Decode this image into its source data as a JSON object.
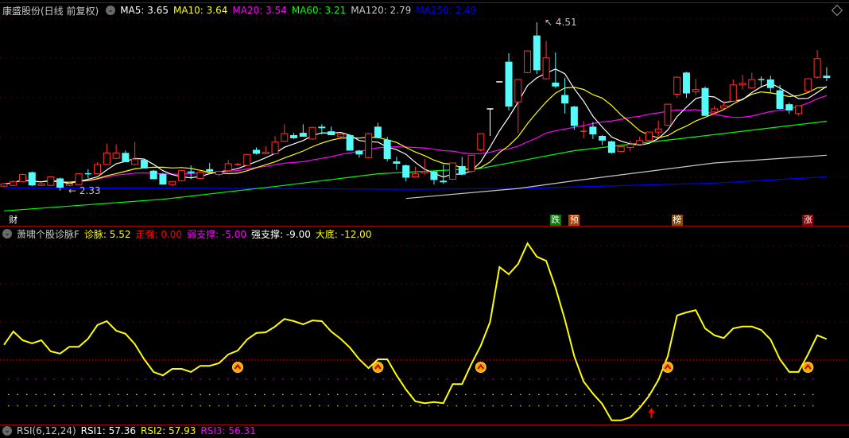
{
  "header": {
    "title": "康盛股份(日线 前复权)",
    "ma": [
      {
        "label": "MA5: 3.65",
        "color": "#ffffff"
      },
      {
        "label": "MA10: 3.64",
        "color": "#ffff00"
      },
      {
        "label": "MA20: 3.54",
        "color": "#ff00ff"
      },
      {
        "label": "MA60: 3.21",
        "color": "#00ff00"
      },
      {
        "label": "MA120: 2.79",
        "color": "#c8c8c8"
      },
      {
        "label": "MA250: 2.49",
        "color": "#0000ff"
      }
    ]
  },
  "main_chart": {
    "high_label": "4.51",
    "low_label": "2.33",
    "candles": [
      [
        2.39,
        2.43,
        2.38,
        2.42
      ],
      [
        2.4,
        2.46,
        2.39,
        2.45
      ],
      [
        2.45,
        2.55,
        2.44,
        2.54
      ],
      [
        2.57,
        2.58,
        2.39,
        2.4
      ],
      [
        2.4,
        2.43,
        2.39,
        2.42
      ],
      [
        2.4,
        2.52,
        2.39,
        2.51
      ],
      [
        2.49,
        2.5,
        2.33,
        2.37
      ],
      [
        2.4,
        2.43,
        2.39,
        2.42
      ],
      [
        2.41,
        2.56,
        2.4,
        2.55
      ],
      [
        2.55,
        2.61,
        2.49,
        2.54
      ],
      [
        2.55,
        2.7,
        2.54,
        2.67
      ],
      [
        2.67,
        2.94,
        2.66,
        2.82
      ],
      [
        2.75,
        2.93,
        2.74,
        2.82
      ],
      [
        2.82,
        2.85,
        2.7,
        2.7
      ],
      [
        2.67,
        2.96,
        2.66,
        2.74
      ],
      [
        2.73,
        2.74,
        2.62,
        2.62
      ],
      [
        2.59,
        2.6,
        2.48,
        2.48
      ],
      [
        2.55,
        2.56,
        2.41,
        2.41
      ],
      [
        2.41,
        2.45,
        2.39,
        2.45
      ],
      [
        2.46,
        2.6,
        2.45,
        2.59
      ],
      [
        2.58,
        2.66,
        2.48,
        2.56
      ],
      [
        2.49,
        2.58,
        2.48,
        2.57
      ],
      [
        2.61,
        2.69,
        2.57,
        2.58
      ],
      [
        2.54,
        2.59,
        2.52,
        2.58
      ],
      [
        2.59,
        2.73,
        2.58,
        2.68
      ],
      [
        2.66,
        2.69,
        2.65,
        2.67
      ],
      [
        2.66,
        2.81,
        2.65,
        2.8
      ],
      [
        2.86,
        2.89,
        2.8,
        2.81
      ],
      [
        2.81,
        2.91,
        2.8,
        2.83
      ],
      [
        2.81,
        3.04,
        2.8,
        2.96
      ],
      [
        2.97,
        3.19,
        2.96,
        3.07
      ],
      [
        3.05,
        3.08,
        3.0,
        3.01
      ],
      [
        3.08,
        3.19,
        3.03,
        3.03
      ],
      [
        3.0,
        3.16,
        2.99,
        3.15
      ],
      [
        3.16,
        3.19,
        3.06,
        3.14
      ],
      [
        3.1,
        3.16,
        3.05,
        3.05
      ],
      [
        3.03,
        3.07,
        3.02,
        3.06
      ],
      [
        3.05,
        3.06,
        2.85,
        2.85
      ],
      [
        2.85,
        2.86,
        2.76,
        2.8
      ],
      [
        2.76,
        3.08,
        2.75,
        3.07
      ],
      [
        3.16,
        3.21,
        3.01,
        3.02
      ],
      [
        2.99,
        3.03,
        2.71,
        2.74
      ],
      [
        2.71,
        2.77,
        2.6,
        2.68
      ],
      [
        2.66,
        2.67,
        2.45,
        2.5
      ],
      [
        2.51,
        2.64,
        2.5,
        2.55
      ],
      [
        2.56,
        2.74,
        2.54,
        2.58
      ],
      [
        2.58,
        2.59,
        2.41,
        2.47
      ],
      [
        2.46,
        2.67,
        2.42,
        2.44
      ],
      [
        2.48,
        2.69,
        2.47,
        2.69
      ],
      [
        2.65,
        2.77,
        2.53,
        2.54
      ],
      [
        2.58,
        2.79,
        2.56,
        2.79
      ],
      [
        2.86,
        3.07,
        2.84,
        3.07
      ],
      [
        3.39,
        3.39,
        3.04,
        3.39
      ],
      [
        3.74,
        3.74,
        3.74,
        3.74
      ],
      [
        4.0,
        4.11,
        3.37,
        3.42
      ],
      [
        3.48,
        3.77,
        3.08,
        3.77
      ],
      [
        3.86,
        4.14,
        3.85,
        4.14
      ],
      [
        4.34,
        4.51,
        3.84,
        3.89
      ],
      [
        3.78,
        4.27,
        3.77,
        4.05
      ],
      [
        3.73,
        4.12,
        3.66,
        3.68
      ],
      [
        3.57,
        3.79,
        3.33,
        3.46
      ],
      [
        3.42,
        3.43,
        3.12,
        3.17
      ],
      [
        3.09,
        3.23,
        3.01,
        3.1
      ],
      [
        3.16,
        3.22,
        3.0,
        3.06
      ],
      [
        3.04,
        3.05,
        2.92,
        2.98
      ],
      [
        2.97,
        2.98,
        2.81,
        2.82
      ],
      [
        2.84,
        2.91,
        2.83,
        2.9
      ],
      [
        2.89,
        2.98,
        2.84,
        2.93
      ],
      [
        2.93,
        3.03,
        2.92,
        2.98
      ],
      [
        2.98,
        3.09,
        2.97,
        3.09
      ],
      [
        3.09,
        3.24,
        3.02,
        3.13
      ],
      [
        3.18,
        3.46,
        3.17,
        3.45
      ],
      [
        3.58,
        3.81,
        3.53,
        3.8
      ],
      [
        3.86,
        3.87,
        3.53,
        3.59
      ],
      [
        3.61,
        3.78,
        3.57,
        3.64
      ],
      [
        3.66,
        3.68,
        3.3,
        3.3
      ],
      [
        3.35,
        3.43,
        3.31,
        3.39
      ],
      [
        3.4,
        3.49,
        3.39,
        3.43
      ],
      [
        3.49,
        3.77,
        3.48,
        3.7
      ],
      [
        3.7,
        3.83,
        3.64,
        3.72
      ],
      [
        3.66,
        3.86,
        3.65,
        3.77
      ],
      [
        3.77,
        3.81,
        3.68,
        3.76
      ],
      [
        3.77,
        3.82,
        3.59,
        3.66
      ],
      [
        3.63,
        3.7,
        3.38,
        3.39
      ],
      [
        3.45,
        3.47,
        3.33,
        3.37
      ],
      [
        3.33,
        3.43,
        3.3,
        3.43
      ],
      [
        3.62,
        3.78,
        3.61,
        3.78
      ],
      [
        3.8,
        4.15,
        3.78,
        4.04
      ],
      [
        3.82,
        3.93,
        3.75,
        3.79
      ]
    ],
    "long_ma": {
      "ma60": [
        [
          0,
          2.07
        ],
        [
          17,
          2.22
        ],
        [
          30,
          2.4
        ],
        [
          40,
          2.55
        ],
        [
          51,
          2.62
        ],
        [
          61,
          2.85
        ],
        [
          72,
          3.0
        ],
        [
          88,
          3.23
        ]
      ],
      "ma120": [
        [
          43,
          2.23
        ],
        [
          55,
          2.36
        ],
        [
          61,
          2.46
        ],
        [
          76,
          2.69
        ],
        [
          88,
          2.79
        ]
      ],
      "ma250": [
        [
          0,
          2.37
        ],
        [
          30,
          2.36
        ],
        [
          43,
          2.35
        ],
        [
          55,
          2.36
        ],
        [
          61,
          2.38
        ],
        [
          76,
          2.43
        ],
        [
          88,
          2.51
        ]
      ]
    },
    "colors": {
      "up": "#ff3232",
      "down": "#54fcfc",
      "flat": "#ffffff",
      "ma5": "#ffffff",
      "ma10": "#ffff00",
      "ma20": "#ff00ff",
      "ma60": "#00ff00",
      "ma120": "#c8c8c8",
      "ma250": "#0000ff"
    },
    "event_labels": [
      {
        "text": "财",
        "index": 1,
        "color": "#000000",
        "fg": "#ffffff"
      },
      {
        "text": "跌",
        "index": 59,
        "color": "#008000",
        "fg": "#ffffff"
      },
      {
        "text": "预",
        "index": 61,
        "color": "#b04000",
        "fg": "#ffffff"
      },
      {
        "text": "榜",
        "index": 72,
        "color": "#8a4a00",
        "fg": "#ffffff"
      },
      {
        "text": "涨",
        "index": 86,
        "color": "#800000",
        "fg": "#ffffff"
      }
    ]
  },
  "indicator": {
    "title": "萧啸个股诊脉F",
    "items": [
      {
        "label": "诊脉: 5.52",
        "color": "#ffff00"
      },
      {
        "label": "走强: 0.00",
        "color": "#ff0000"
      },
      {
        "label": "弱支撑: -5.00",
        "color": "#ff00ff"
      },
      {
        "label": "强支撑: -9.00",
        "color": "#ffffff"
      },
      {
        "label": "大底: -12.00",
        "color": "#ffff00"
      }
    ],
    "values": [
      4.0,
      7.5,
      5.2,
      4.4,
      5.2,
      2.3,
      1.7,
      3.5,
      3.5,
      5.6,
      9.2,
      10.2,
      7.7,
      6.9,
      4.2,
      0.2,
      -3.1,
      -4.0,
      -2.3,
      -2.3,
      -3.1,
      -1.5,
      -1.5,
      -0.8,
      1.5,
      2.5,
      5.4,
      7.1,
      7.3,
      8.8,
      10.8,
      10.2,
      9.4,
      10.4,
      10.2,
      7.5,
      5.6,
      3.3,
      0.2,
      -2.1,
      0.2,
      0.2,
      -4.0,
      -7.7,
      -10.8,
      -11.3,
      -11.0,
      -11.3,
      -6.3,
      -6.3,
      -1.0,
      3.8,
      10.0,
      24.4,
      22.5,
      25.2,
      30.6,
      27.1,
      26.0,
      19.0,
      10.6,
      1.0,
      -5.6,
      -8.8,
      -11.5,
      -15.8,
      -15.8,
      -15.0,
      -12.5,
      -9.4,
      -5.2,
      1.0,
      11.7,
      12.5,
      13.1,
      8.3,
      6.5,
      5.8,
      8.3,
      8.8,
      8.8,
      7.9,
      5.4,
      0.2,
      -3.1,
      -3.1,
      1.5,
      6.5,
      5.52
    ],
    "levels": [
      {
        "value": 30,
        "color": "#a00000"
      },
      {
        "value": 20,
        "color": "#a00000"
      },
      {
        "value": 10,
        "color": "#a00000"
      },
      {
        "value": 0,
        "color": "#ff0000"
      },
      {
        "value": -5,
        "color": "#ff00ff"
      },
      {
        "value": -9,
        "color": "#ffffff"
      },
      {
        "value": -12,
        "color": "#ffff00"
      }
    ],
    "buy_signals": [
      25,
      40,
      51,
      71,
      86
    ],
    "arrow_signals": [
      69
    ]
  },
  "rsi": {
    "title": "RSI(6,12,24)",
    "items": [
      {
        "label": "RSI1: 57.36",
        "color": "#ffffff"
      },
      {
        "label": "RSI2: 57.93",
        "color": "#ffff00"
      },
      {
        "label": "RSI3: 56.31",
        "color": "#ff00ff"
      }
    ]
  }
}
